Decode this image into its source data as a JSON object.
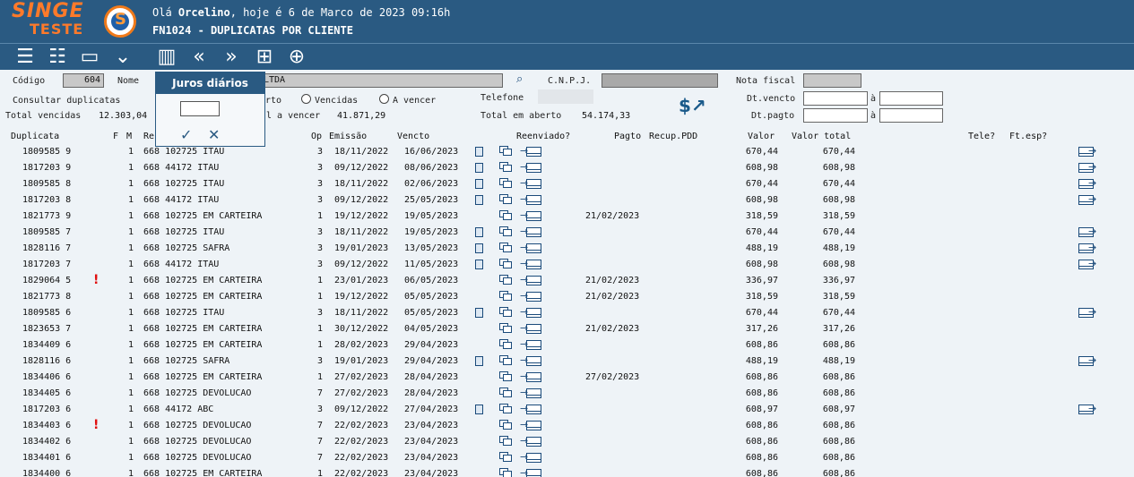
{
  "header": {
    "logo": "SINGE",
    "logo_sub": "TESTE",
    "greeting_prefix": "Olá",
    "user": "Orcelino",
    "greeting_suffix": ", hoje é 6 de Marco de 2023 09:16h",
    "screen_title": "FN1024 - DUPLICATAS POR CLIENTE"
  },
  "toolbar_icons": [
    "list-icon",
    "checklist-icon",
    "card-icon",
    "double-chevron-down-icon",
    "book-icon",
    "double-chevron-left-icon",
    "double-chevron-right-icon",
    "calculator-icon",
    "zoom-icon"
  ],
  "form": {
    "codigo_label": "Código",
    "codigo_value": "604",
    "nome_label": "Nome",
    "nome_value": "LTDA",
    "cnpj_label": "C.N.P.J.",
    "nota_fiscal_label": "Nota fiscal",
    "consultar_label": "Consultar duplicatas",
    "radio_aberto_label": "rto",
    "radio_vencidas_label": "Vencidas",
    "radio_avencer_label": "A vencer",
    "telefone_label": "Telefone",
    "dt_vencto_label": "Dt.vencto",
    "dt_pagto_label": "Dt.pagto",
    "a_label": "à",
    "total_vencidas_label": "Total vencidas",
    "total_vencidas_value": "12.303,04",
    "total_avencer_label": "l a vencer",
    "total_avencer_value": "41.871,29",
    "total_aberto_label": "Total em aberto",
    "total_aberto_value": "54.174,33"
  },
  "popup": {
    "title": "Juros diários",
    "confirm_icon": "check-icon",
    "cancel_icon": "close-icon"
  },
  "table": {
    "headers": {
      "duplicata": "Duplicata",
      "f": "F",
      "m": "M",
      "re": "Re",
      "op": "Op",
      "emissao": "Emissão",
      "vencto": "Vencto",
      "reenviado": "Reenviado?",
      "pagto": "Pagto",
      "recup_pdd": "Recup.PDD",
      "valor": "Valor",
      "valor_total": "Valor total",
      "tele": "Tele?",
      "ft_esp": "Ft.esp?"
    },
    "rows": [
      {
        "dup": "1809585 9",
        "flag": false,
        "m": "1",
        "re": "668 102725 ITAU",
        "op": "3",
        "emissao": "18/11/2022",
        "vencto": "16/06/2023",
        "doc": true,
        "pagto": "",
        "valor": "670,44",
        "total": "670,44",
        "mail": true
      },
      {
        "dup": "1817203 9",
        "flag": false,
        "m": "1",
        "re": "668  44172 ITAU",
        "op": "3",
        "emissao": "09/12/2022",
        "vencto": "08/06/2023",
        "doc": true,
        "pagto": "",
        "valor": "608,98",
        "total": "608,98",
        "mail": true
      },
      {
        "dup": "1809585 8",
        "flag": false,
        "m": "1",
        "re": "668 102725 ITAU",
        "op": "3",
        "emissao": "18/11/2022",
        "vencto": "02/06/2023",
        "doc": true,
        "pagto": "",
        "valor": "670,44",
        "total": "670,44",
        "mail": true
      },
      {
        "dup": "1817203 8",
        "flag": false,
        "m": "1",
        "re": "668  44172 ITAU",
        "op": "3",
        "emissao": "09/12/2022",
        "vencto": "25/05/2023",
        "doc": true,
        "pagto": "",
        "valor": "608,98",
        "total": "608,98",
        "mail": true
      },
      {
        "dup": "1821773 9",
        "flag": false,
        "m": "1",
        "re": "668 102725 EM CARTEIRA",
        "op": "1",
        "emissao": "19/12/2022",
        "vencto": "19/05/2023",
        "doc": false,
        "pagto": "21/02/2023",
        "valor": "318,59",
        "total": "318,59",
        "mail": false
      },
      {
        "dup": "1809585 7",
        "flag": false,
        "m": "1",
        "re": "668 102725 ITAU",
        "op": "3",
        "emissao": "18/11/2022",
        "vencto": "19/05/2023",
        "doc": true,
        "pagto": "",
        "valor": "670,44",
        "total": "670,44",
        "mail": true
      },
      {
        "dup": "1828116 7",
        "flag": false,
        "m": "1",
        "re": "668 102725 SAFRA",
        "op": "3",
        "emissao": "19/01/2023",
        "vencto": "13/05/2023",
        "doc": true,
        "pagto": "",
        "valor": "488,19",
        "total": "488,19",
        "mail": true
      },
      {
        "dup": "1817203 7",
        "flag": false,
        "m": "1",
        "re": "668  44172 ITAU",
        "op": "3",
        "emissao": "09/12/2022",
        "vencto": "11/05/2023",
        "doc": true,
        "pagto": "",
        "valor": "608,98",
        "total": "608,98",
        "mail": true
      },
      {
        "dup": "1829064 5",
        "flag": true,
        "m": "1",
        "re": "668 102725 EM CARTEIRA",
        "op": "1",
        "emissao": "23/01/2023",
        "vencto": "06/05/2023",
        "doc": false,
        "pagto": "21/02/2023",
        "valor": "336,97",
        "total": "336,97",
        "mail": false
      },
      {
        "dup": "1821773 8",
        "flag": false,
        "m": "1",
        "re": "668 102725 EM CARTEIRA",
        "op": "1",
        "emissao": "19/12/2022",
        "vencto": "05/05/2023",
        "doc": false,
        "pagto": "21/02/2023",
        "valor": "318,59",
        "total": "318,59",
        "mail": false
      },
      {
        "dup": "1809585 6",
        "flag": false,
        "m": "1",
        "re": "668 102725 ITAU",
        "op": "3",
        "emissao": "18/11/2022",
        "vencto": "05/05/2023",
        "doc": true,
        "pagto": "",
        "valor": "670,44",
        "total": "670,44",
        "mail": true
      },
      {
        "dup": "1823653 7",
        "flag": false,
        "m": "1",
        "re": "668 102725 EM CARTEIRA",
        "op": "1",
        "emissao": "30/12/2022",
        "vencto": "04/05/2023",
        "doc": false,
        "pagto": "21/02/2023",
        "valor": "317,26",
        "total": "317,26",
        "mail": false
      },
      {
        "dup": "1834409 6",
        "flag": false,
        "m": "1",
        "re": "668 102725 EM CARTEIRA",
        "op": "1",
        "emissao": "28/02/2023",
        "vencto": "29/04/2023",
        "doc": false,
        "pagto": "",
        "valor": "608,86",
        "total": "608,86",
        "mail": false
      },
      {
        "dup": "1828116 6",
        "flag": false,
        "m": "1",
        "re": "668 102725 SAFRA",
        "op": "3",
        "emissao": "19/01/2023",
        "vencto": "29/04/2023",
        "doc": true,
        "pagto": "",
        "valor": "488,19",
        "total": "488,19",
        "mail": true
      },
      {
        "dup": "1834406 6",
        "flag": false,
        "m": "1",
        "re": "668 102725 EM CARTEIRA",
        "op": "1",
        "emissao": "27/02/2023",
        "vencto": "28/04/2023",
        "doc": false,
        "pagto": "27/02/2023",
        "valor": "608,86",
        "total": "608,86",
        "mail": false
      },
      {
        "dup": "1834405 6",
        "flag": false,
        "m": "1",
        "re": "668 102725 DEVOLUCAO",
        "op": "7",
        "emissao": "27/02/2023",
        "vencto": "28/04/2023",
        "doc": false,
        "pagto": "",
        "valor": "608,86",
        "total": "608,86",
        "mail": false
      },
      {
        "dup": "1817203 6",
        "flag": false,
        "m": "1",
        "re": "668  44172 ABC",
        "op": "3",
        "emissao": "09/12/2022",
        "vencto": "27/04/2023",
        "doc": true,
        "pagto": "",
        "valor": "608,97",
        "total": "608,97",
        "mail": true
      },
      {
        "dup": "1834403 6",
        "flag": true,
        "m": "1",
        "re": "668 102725 DEVOLUCAO",
        "op": "7",
        "emissao": "22/02/2023",
        "vencto": "23/04/2023",
        "doc": false,
        "pagto": "",
        "valor": "608,86",
        "total": "608,86",
        "mail": false
      },
      {
        "dup": "1834402 6",
        "flag": false,
        "m": "1",
        "re": "668 102725 DEVOLUCAO",
        "op": "7",
        "emissao": "22/02/2023",
        "vencto": "23/04/2023",
        "doc": false,
        "pagto": "",
        "valor": "608,86",
        "total": "608,86",
        "mail": false
      },
      {
        "dup": "1834401 6",
        "flag": false,
        "m": "1",
        "re": "668 102725 DEVOLUCAO",
        "op": "7",
        "emissao": "22/02/2023",
        "vencto": "23/04/2023",
        "doc": false,
        "pagto": "",
        "valor": "608,86",
        "total": "608,86",
        "mail": false
      },
      {
        "dup": "1834400 6",
        "flag": false,
        "m": "1",
        "re": "668 102725 EM CARTEIRA",
        "op": "1",
        "emissao": "22/02/2023",
        "vencto": "23/04/2023",
        "doc": false,
        "pagto": "",
        "valor": "608,86",
        "total": "608,86",
        "mail": false
      }
    ]
  }
}
